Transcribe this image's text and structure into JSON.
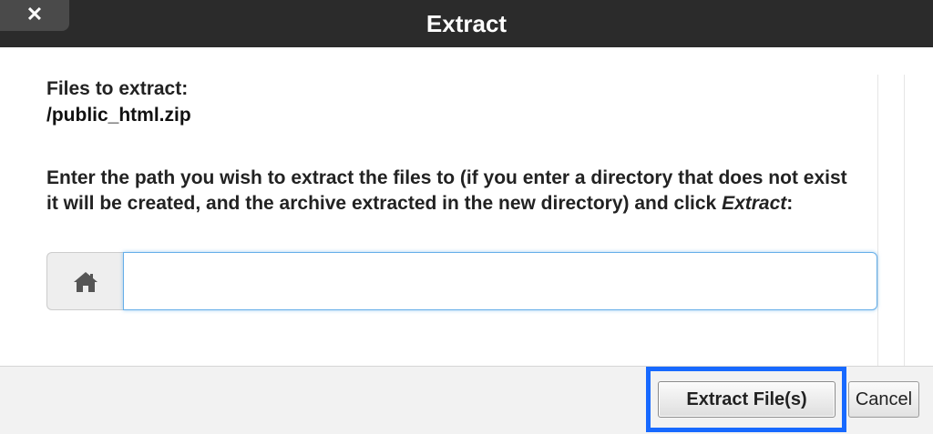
{
  "dialog": {
    "title": "Extract",
    "close_label": "✕"
  },
  "files": {
    "label": "Files to extract:",
    "value": "/public_html.zip"
  },
  "instructions": {
    "before_em": "Enter the path you wish to extract the files to (if you enter a directory that does not exist it will be created, and the archive extracted in the new directory) and click ",
    "em": "Extract",
    "after_em": ":"
  },
  "path_input": {
    "value": "",
    "placeholder": "",
    "icon": "home-icon"
  },
  "footer": {
    "extract_label": "Extract File(s)",
    "cancel_label": "Cancel",
    "highlight_color": "#1769ff"
  }
}
